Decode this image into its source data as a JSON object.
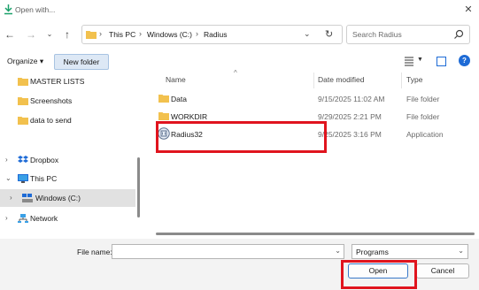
{
  "window": {
    "title": "Open with..."
  },
  "address": {
    "crumbs": [
      "This PC",
      "Windows (C:)",
      "Radius"
    ]
  },
  "search": {
    "placeholder": "Search Radius"
  },
  "toolbar": {
    "organize_label": "Organize ▾",
    "new_folder_label": "New folder"
  },
  "sidebar": {
    "items": [
      {
        "label": "MASTER LISTS",
        "icon": "folder-icon"
      },
      {
        "label": "Screenshots",
        "icon": "folder-icon"
      },
      {
        "label": "data to send",
        "icon": "folder-icon"
      },
      {
        "label": "Dropbox",
        "icon": "dropbox-icon"
      },
      {
        "label": "This PC",
        "icon": "computer-icon"
      },
      {
        "label": "Windows (C:)",
        "icon": "drive-icon"
      },
      {
        "label": "Network",
        "icon": "network-icon"
      }
    ]
  },
  "files": {
    "columns": [
      "Name",
      "Date modified",
      "Type"
    ],
    "rows": [
      {
        "name": "Data",
        "date": "9/15/2025 11:02 AM",
        "type": "File folder",
        "icon": "folder-icon"
      },
      {
        "name": "WORKDIR",
        "date": "9/29/2025 2:21 PM",
        "type": "File folder",
        "icon": "folder-icon"
      },
      {
        "name": "Radius32",
        "date": "9/25/2025 3:16 PM",
        "type": "Application",
        "icon": "application-icon"
      }
    ]
  },
  "footer": {
    "file_name_label": "File name:",
    "file_name_value": "",
    "filter_value": "Programs",
    "open_label": "Open",
    "cancel_label": "Cancel"
  },
  "colors": {
    "accent": "#1e6bd6",
    "highlight": "#e0141e",
    "folder": "#f2c14e"
  }
}
